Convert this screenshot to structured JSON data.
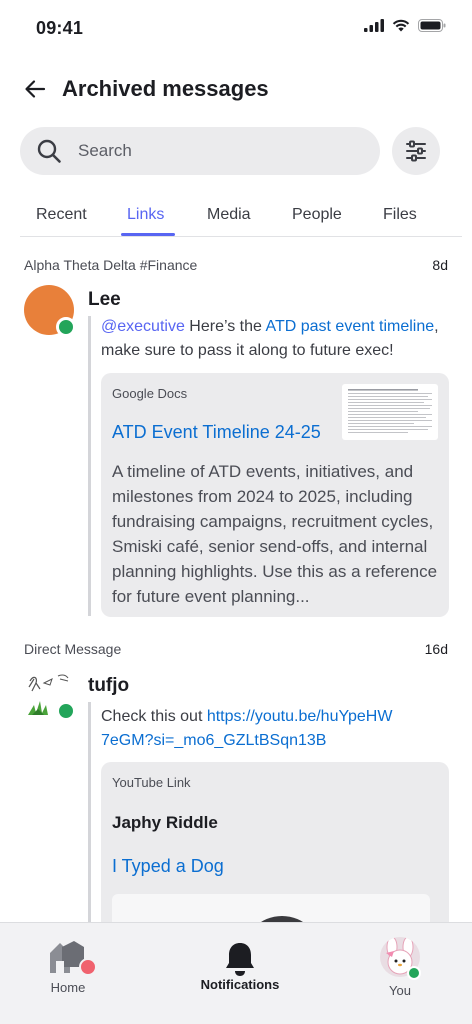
{
  "status_bar": {
    "time": "09:41"
  },
  "header": {
    "title": "Archived messages"
  },
  "search": {
    "placeholder": "Search"
  },
  "tabs": [
    {
      "label": "Recent",
      "active": false
    },
    {
      "label": "Links",
      "active": true
    },
    {
      "label": "Media",
      "active": false
    },
    {
      "label": "People",
      "active": false
    },
    {
      "label": "Files",
      "active": false
    }
  ],
  "messages": [
    {
      "channel": "Alpha Theta Delta #Finance",
      "age": "8d",
      "author": "Lee",
      "avatar_color": "#e8803a",
      "text": {
        "mention": "@executive",
        "before_link": " Here’s the ",
        "link": "ATD past event timeline",
        "after_link": ", make sure to pass it along to future exec!"
      },
      "embed": {
        "provider": "Google Docs",
        "title": "ATD Event Timeline 24-25",
        "description": "A timeline of ATD events, initiatives, and milestones from 2024 to 2025, including fundraising campaigns, recruitment cycles, Smiski café, senior send-offs, and internal planning highlights. Use this as a reference for future event planning..."
      }
    },
    {
      "channel": "Direct Message",
      "age": "16d",
      "author": "tufjo",
      "text": {
        "before_link": "Check this out ",
        "link": "https://youtu.be/huYpeHW7eGM?si=_mo6_GZLtBSqn13B"
      },
      "embed": {
        "provider": "YouTube Link",
        "author": "Japhy Riddle",
        "title": "I Typed a Dog"
      }
    }
  ],
  "bottom_nav": [
    {
      "label": "Home",
      "icon": "home-icon",
      "active": false
    },
    {
      "label": "Notifications",
      "icon": "bell-icon",
      "active": true
    },
    {
      "label": "You",
      "icon": "avatar",
      "active": false
    }
  ],
  "colors": {
    "accent": "#5865f2",
    "link": "#0b6ed1",
    "online": "#23a55a",
    "unread_badge": "#f0626e"
  }
}
